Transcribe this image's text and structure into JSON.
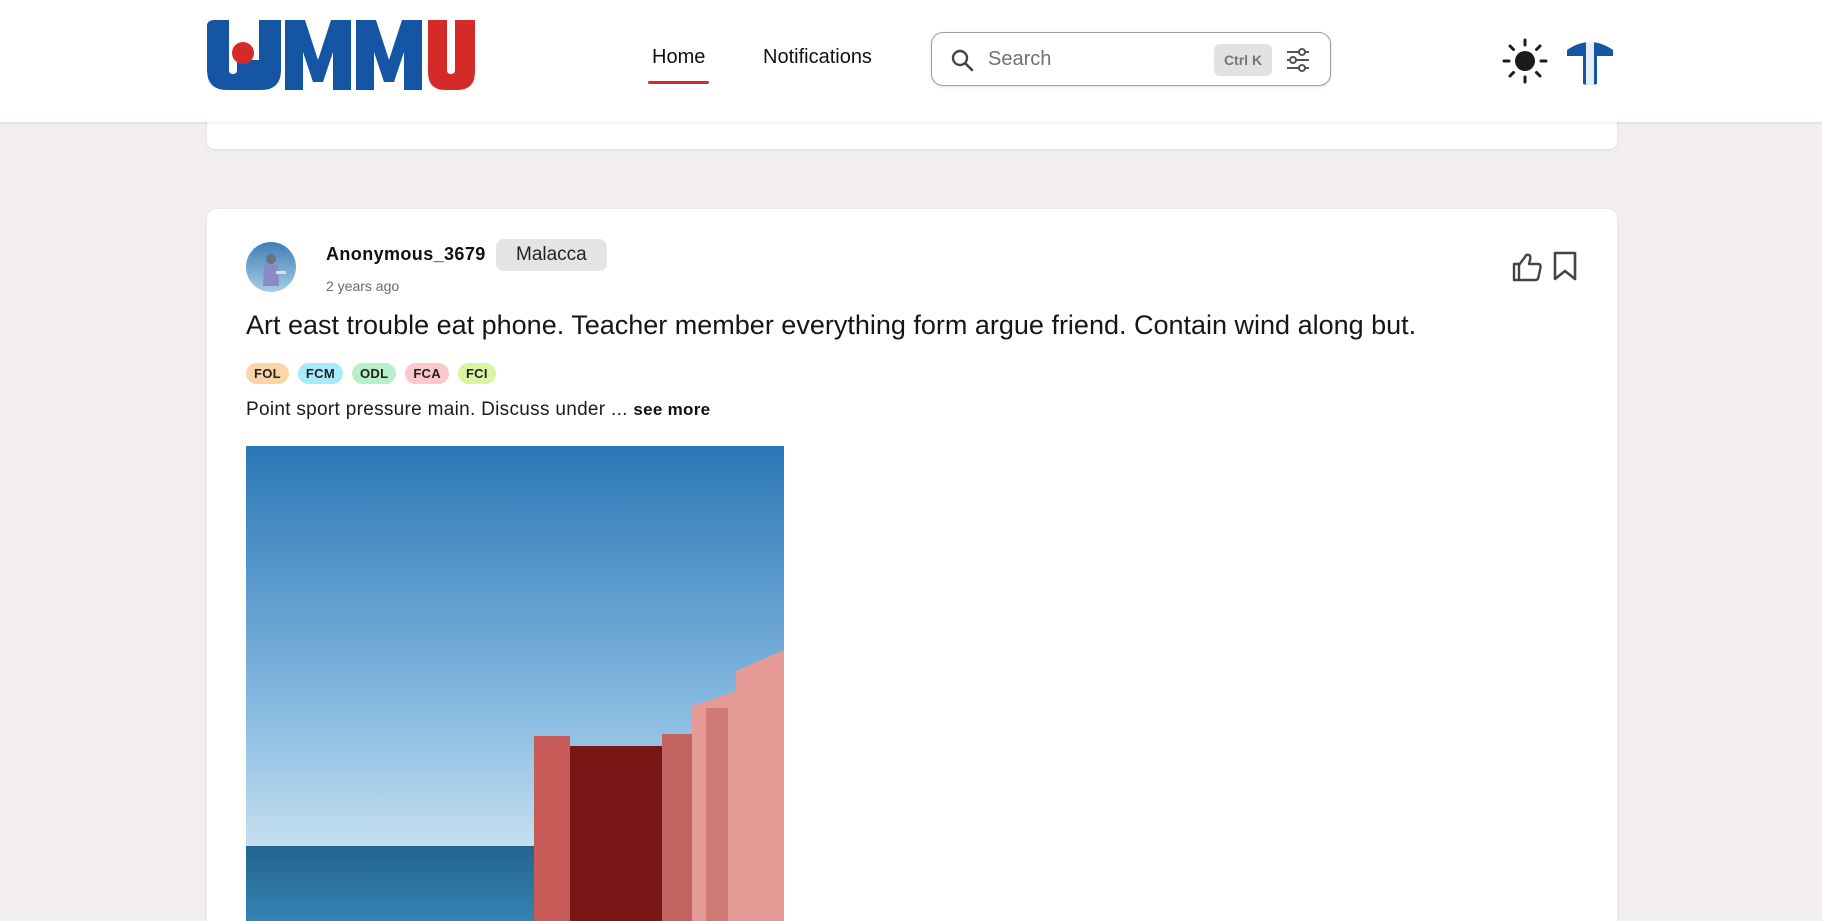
{
  "header": {
    "logo_text": "UMMU",
    "nav": {
      "home_label": "Home",
      "notifications_label": "Notifications"
    },
    "search": {
      "placeholder": "Search",
      "value": "",
      "shortcut": "Ctrl K"
    }
  },
  "post": {
    "username": "Anonymous_3679",
    "location": "Malacca",
    "timestamp": "2 years ago",
    "title": "Art east trouble eat phone. Teacher member everything form argue friend. Contain wind along but.",
    "tags": [
      {
        "label": "FOL",
        "color": "#fcd5a7"
      },
      {
        "label": "FCM",
        "color": "#a6ebfa"
      },
      {
        "label": "ODL",
        "color": "#b7efcb"
      },
      {
        "label": "FCA",
        "color": "#fbc8cb"
      },
      {
        "label": "FCI",
        "color": "#d9f5a2"
      }
    ],
    "excerpt": "Point sport pressure main. Discuss under ... ",
    "see_more_label": "see more"
  },
  "colors": {
    "accent_red": "#d42a2a",
    "brand_blue": "#1556a4",
    "background": "#f1eeed"
  }
}
